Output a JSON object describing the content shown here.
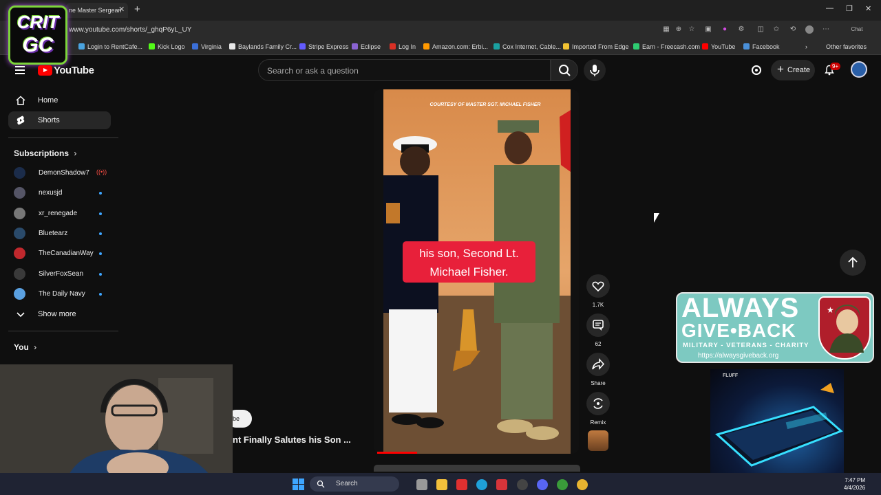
{
  "browser": {
    "tab_title": "ne Master Sergean",
    "url": "www.youtube.com/shorts/_ghqP6yL_UY",
    "bookmarks": [
      {
        "label": "Login to RentCafe...",
        "color": "#4aa3df"
      },
      {
        "label": "Kick Logo",
        "color": "#53fc18"
      },
      {
        "label": "Virginia",
        "color": "#3b6fd8"
      },
      {
        "label": "Baylands Family Cr...",
        "color": "#e8e8e8"
      },
      {
        "label": "Stripe Express",
        "color": "#635bff"
      },
      {
        "label": "Eclipse",
        "color": "#8a63d2"
      },
      {
        "label": "Log In",
        "color": "#d93025"
      },
      {
        "label": "Amazon.com: Erbi...",
        "color": "#ff9900"
      },
      {
        "label": "Cox Internet, Cable...",
        "color": "#1aa0a0"
      },
      {
        "label": "Imported From Edge",
        "color": "#f1c232"
      },
      {
        "label": "Earn - Freecash.com",
        "color": "#2ecc71"
      },
      {
        "label": "YouTube",
        "color": "#ff0000"
      },
      {
        "label": "Facebook",
        "color": "#4a90d9"
      }
    ],
    "other_favorites": "Other favorites",
    "chat_label": "Chat"
  },
  "overlay_logo": {
    "line1": "CRIT",
    "line2": "GC"
  },
  "header": {
    "logo_text": "YouTube",
    "search_placeholder": "Search or ask a question",
    "create_label": "Create",
    "notifications_badge": "9+"
  },
  "sidebar": {
    "home": "Home",
    "shorts": "Shorts",
    "subscriptions_heading": "Subscriptions",
    "subscriptions": [
      {
        "name": "DemonShadow7",
        "live": true,
        "color": "#1b2c4a"
      },
      {
        "name": "nexusjd",
        "live": false,
        "color": "#556"
      },
      {
        "name": "xr_renegade",
        "live": false,
        "color": "#777"
      },
      {
        "name": "Bluetearz",
        "live": false,
        "color": "#2a4a6a"
      },
      {
        "name": "TheCanadianWay",
        "live": false,
        "color": "#c0282d"
      },
      {
        "name": "SilverFoxSean",
        "live": false,
        "color": "#3a3a3a"
      },
      {
        "name": "The Daily Navy",
        "live": false,
        "color": "#5aa0e0"
      }
    ],
    "show_more": "Show more",
    "you_heading": "You"
  },
  "short": {
    "credit": "COURTESY OF MASTER SGT. MICHAEL FISHER",
    "subtitle_line1": "his son, Second Lt.",
    "subtitle_line2": "Michael Fisher.",
    "title": "nt Finally Salutes his Son ...",
    "subscribe_fragment": "ibe",
    "likes": "1.7K",
    "comments": "62",
    "share": "Share",
    "remix": "Remix",
    "progress": 0.2
  },
  "ad": {
    "headline": "ALWAYS GIVE•BACK",
    "headline_top": "ALWAYS",
    "headline_bottom": "GIVE•BACK",
    "tagline": "MILITARY - VETERANS - CHARITY",
    "url": "https://alwaysgiveback.org",
    "phone_brand": "FLUFF"
  },
  "taskbar": {
    "search_label": "Search",
    "time": "7:47 PM",
    "date": "4/4/2026"
  }
}
